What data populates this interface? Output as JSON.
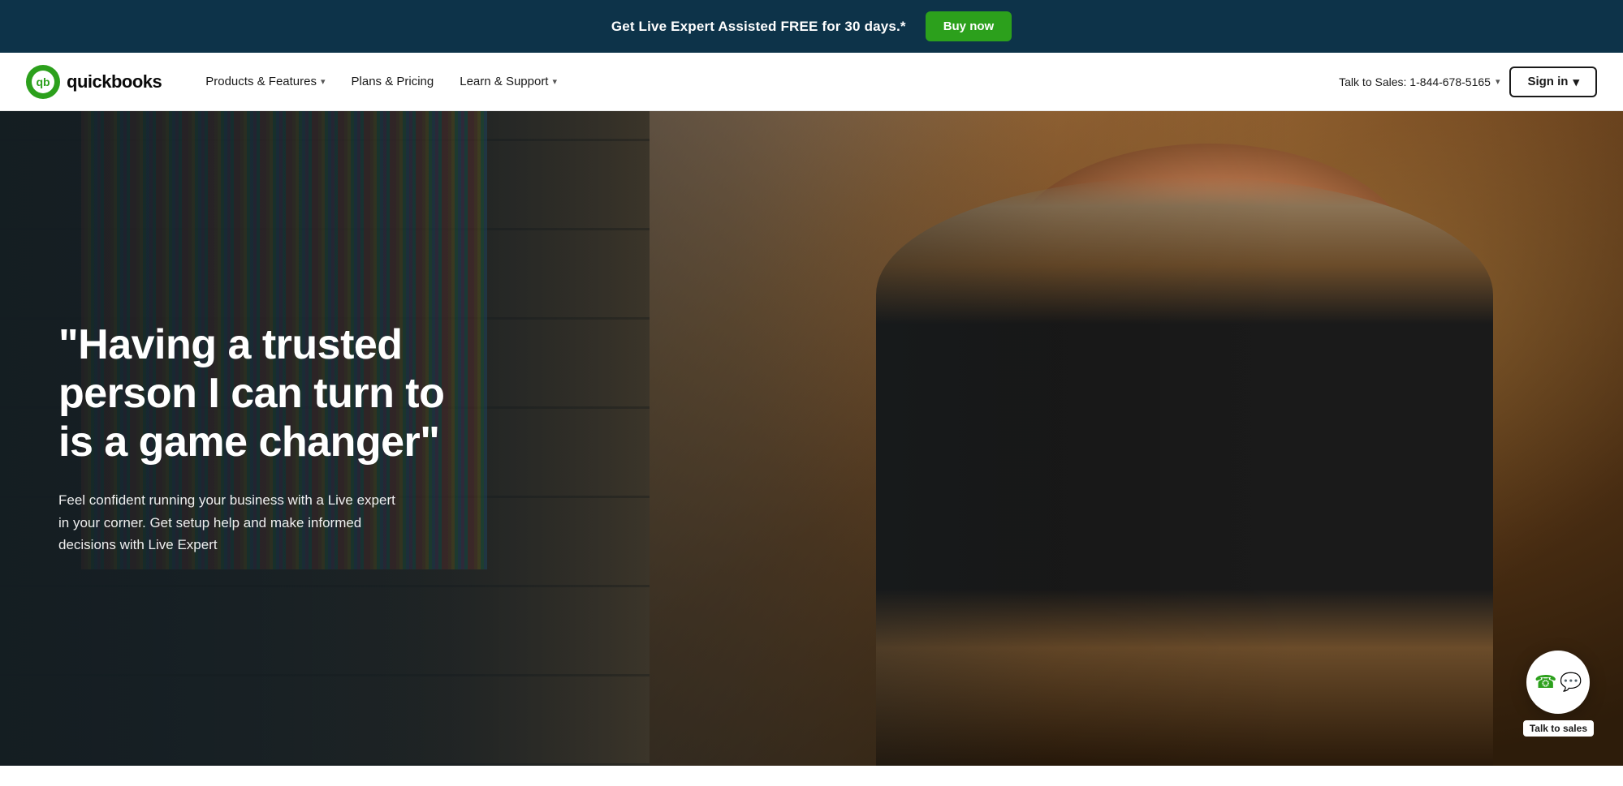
{
  "banner": {
    "text": "Get Live Expert Assisted FREE for 30 days.*",
    "cta_label": "Buy now"
  },
  "nav": {
    "logo_text": "quickbooks",
    "products_label": "Products & Features",
    "plans_label": "Plans & Pricing",
    "learn_label": "Learn & Support",
    "talk_to_sales": "Talk to Sales: 1-844-678-5165",
    "sign_in_label": "Sign in"
  },
  "hero": {
    "quote": "\"Having a trusted person I can turn to is a game changer\"",
    "subtext": "Feel confident running your business with a Live expert in your corner. Get setup help and make informed decisions with Live Expert"
  },
  "chat_widget": {
    "label": "Talk to sales"
  }
}
